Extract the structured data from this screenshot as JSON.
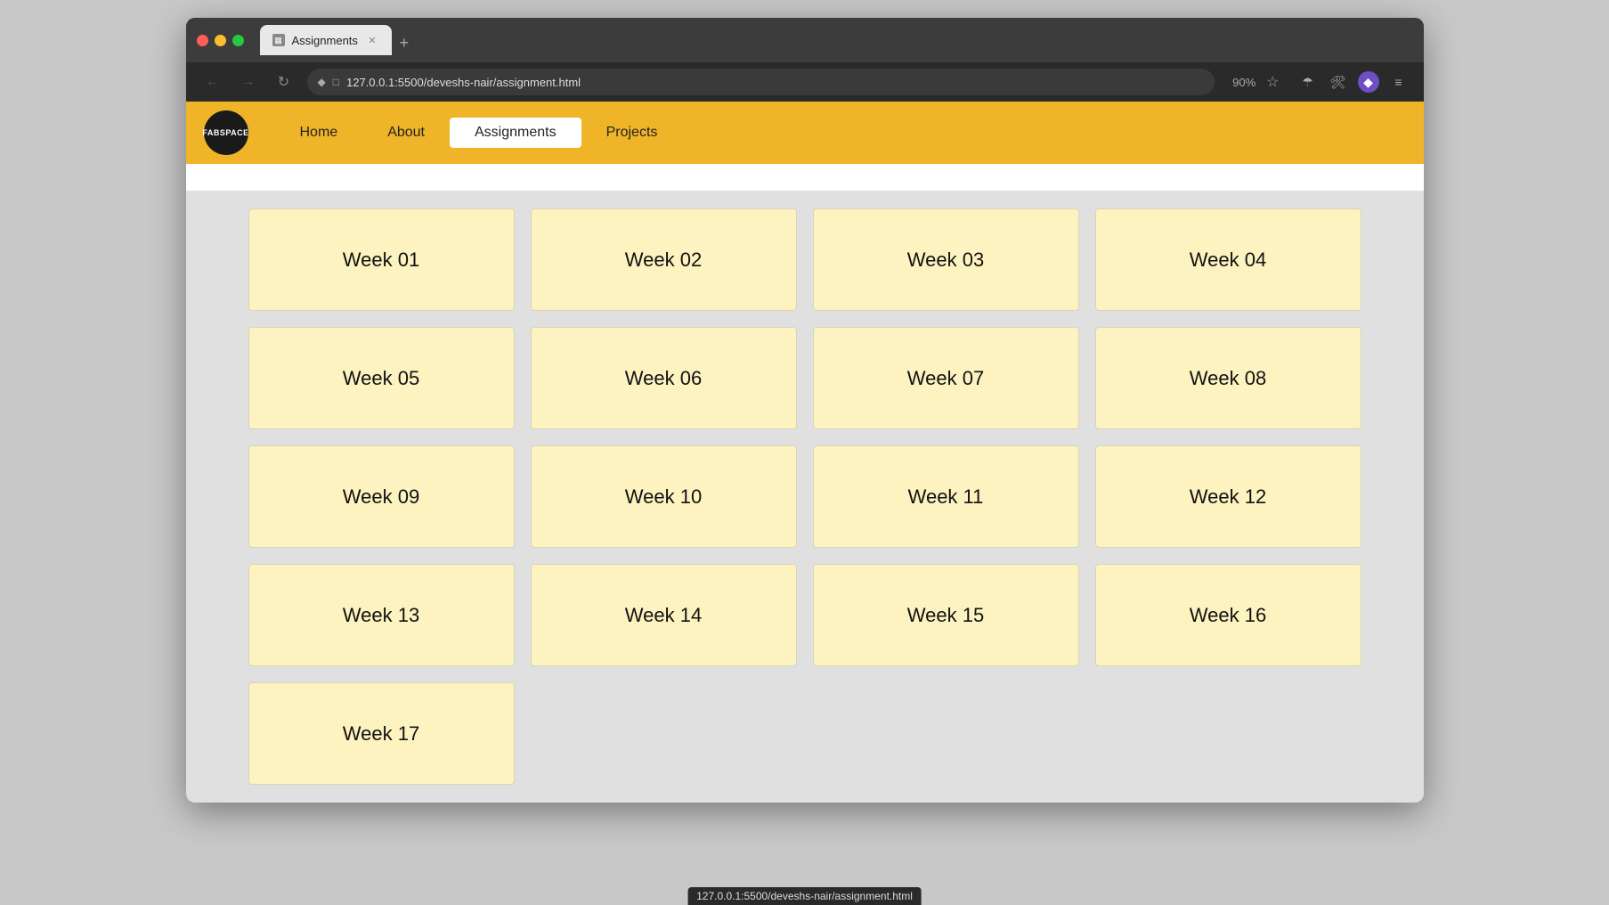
{
  "browser": {
    "tab_label": "Assignments",
    "url": "127.0.0.1:5500/deveshs-nair/assignment.html",
    "zoom": "90%",
    "status_url": "127.0.0.1:5500/deveshs-nair/assignment.html"
  },
  "nav": {
    "logo_text": "FABSPACE",
    "links": [
      {
        "label": "Home",
        "active": false
      },
      {
        "label": "About",
        "active": false
      },
      {
        "label": "Assignments",
        "active": true
      },
      {
        "label": "Projects",
        "active": false
      }
    ]
  },
  "weeks": [
    "Week 01",
    "Week 02",
    "Week 03",
    "Week 04",
    "Week 05",
    "Week 06",
    "Week 07",
    "Week 08",
    "Week 09",
    "Week 10",
    "Week 11",
    "Week 12",
    "Week 13",
    "Week 14",
    "Week 15",
    "Week 16",
    "Week 17"
  ]
}
